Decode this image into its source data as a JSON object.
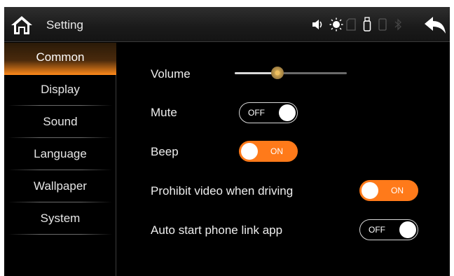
{
  "header": {
    "title": "Setting",
    "home_icon": "home-icon",
    "back_icon": "back-arrow-icon",
    "status_icons": [
      "speaker-icon",
      "brightness-icon",
      "sd-card-icon",
      "usb-icon",
      "phone-icon",
      "bluetooth-icon"
    ]
  },
  "sidebar": {
    "items": [
      {
        "label": "Common",
        "active": true
      },
      {
        "label": "Display",
        "active": false
      },
      {
        "label": "Sound",
        "active": false
      },
      {
        "label": "Language",
        "active": false
      },
      {
        "label": "Wallpaper",
        "active": false
      },
      {
        "label": "System",
        "active": false
      }
    ]
  },
  "settings": {
    "volume": {
      "label": "Volume",
      "level": 0.38
    },
    "mute": {
      "label": "Mute",
      "state": "OFF"
    },
    "beep": {
      "label": "Beep",
      "state": "ON"
    },
    "prohibit_video": {
      "label": "Prohibit video when driving",
      "state": "ON"
    },
    "auto_start": {
      "label": "Auto start phone link app",
      "state": "OFF"
    }
  },
  "colors": {
    "accent": "#ff7a1a",
    "background": "#000000",
    "text": "#eeeeee"
  }
}
